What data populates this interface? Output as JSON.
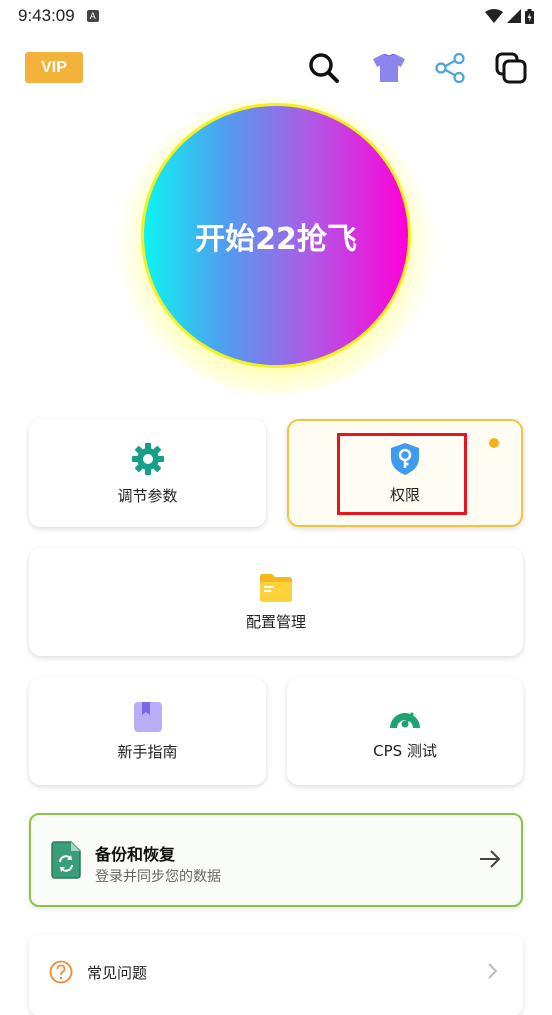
{
  "status_bar": {
    "time": "9:43:09",
    "notification_icon_letter": "A"
  },
  "top_bar": {
    "vip_label": "VIP",
    "icons": [
      "search-icon",
      "tshirt-icon",
      "share-icon",
      "copy-windows-icon"
    ]
  },
  "start_button": {
    "label": "开始22抢飞"
  },
  "tiles": {
    "adjust_params": {
      "label": "调节参数",
      "icon": "gear-icon"
    },
    "permissions": {
      "label": "权限",
      "icon": "shield-key-icon"
    },
    "config_manage": {
      "label": "配置管理",
      "icon": "folder-icon"
    },
    "guide": {
      "label": "新手指南",
      "icon": "bookmark-icon"
    },
    "cps_test": {
      "label": "CPS 测试",
      "icon": "speedometer-icon"
    }
  },
  "backup": {
    "title": "备份和恢复",
    "subtitle": "登录并同步您的数据",
    "icon": "sync-document-icon"
  },
  "faq": {
    "label": "常见问题",
    "icon": "question-circle-icon"
  },
  "colors": {
    "vip": "#f3b33b",
    "highlight": "#e8141e",
    "notify_dot": "#f7b21b",
    "backup_border": "#8bc34a",
    "permissions_border": "#f2c53c"
  }
}
